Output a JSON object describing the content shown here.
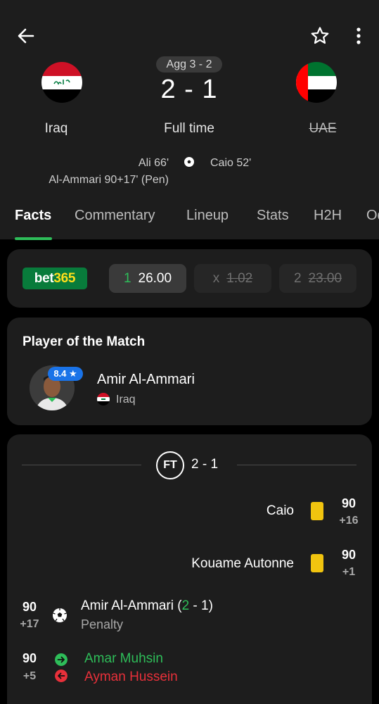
{
  "header": {
    "agg": "Agg 3 - 2",
    "score": "2 - 1",
    "status": "Full time",
    "home_team": "Iraq",
    "away_team": "UAE",
    "home_scorers": [
      "Ali 66'",
      "Al-Ammari 90+17' (Pen)"
    ],
    "away_scorers": [
      "Caio 52'"
    ]
  },
  "tabs": [
    "Facts",
    "Commentary",
    "Lineup",
    "Stats",
    "H2H",
    "Od"
  ],
  "odds": {
    "bookmaker_a": "bet",
    "bookmaker_b": "365",
    "home_label": "1",
    "home_value": "26.00",
    "draw_label": "x",
    "draw_value": "1.02",
    "away_label": "2",
    "away_value": "23.00"
  },
  "potm": {
    "title": "Player of the Match",
    "rating": "8.4",
    "player": "Amir Al-Ammari",
    "team": "Iraq"
  },
  "events": {
    "ft_label": "FT",
    "ft_score": "2 - 1",
    "items": [
      {
        "min": "90",
        "add": "+16",
        "name": "Caio"
      },
      {
        "min": "90",
        "add": "+1",
        "name": "Kouame Autonne"
      },
      {
        "min": "90",
        "add": "+17",
        "name_pre": "Amir Al-Ammari (",
        "name_hl": "2",
        "name_post": " - 1)",
        "sub": "Penalty"
      },
      {
        "min": "90",
        "add": "+5",
        "sub_in": "Amar Muhsin",
        "sub_out": "Ayman Hussein"
      }
    ]
  },
  "colors": {
    "accent": "#2ebd59",
    "red": "#e8303a",
    "card": "#1d1d1d",
    "yellow_card": "#f1c40f"
  }
}
